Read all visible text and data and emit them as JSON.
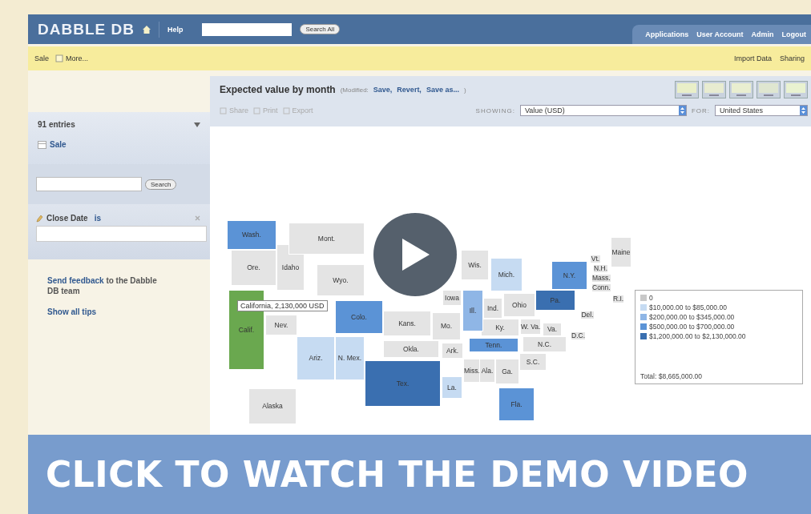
{
  "top_bar": {
    "logo": "DABBLE DB",
    "help": "Help",
    "search_button": "Search All",
    "nav": [
      "Applications",
      "User Account",
      "Admin",
      "Logout"
    ]
  },
  "sub_bar": {
    "left": [
      "Sale",
      "More..."
    ],
    "right": [
      "Import Data",
      "Sharing"
    ]
  },
  "sidebar": {
    "entries": "91 entries",
    "view_link": "Sale",
    "search_button": "Search",
    "filter": {
      "field": "Close Date",
      "operator": "is"
    },
    "feedback_link": "Send feedback",
    "feedback_rest": "to the Dabble DB team",
    "tips_link": "Show all tips"
  },
  "report": {
    "title": "Expected value by month",
    "modified": "(Modified:",
    "actions": [
      "Save,",
      "Revert,",
      "Save as..."
    ],
    "close_paren": ")",
    "tools": [
      {
        "label": "Share",
        "disabled": true
      },
      {
        "label": "Print",
        "disabled": true
      },
      {
        "label": "Export",
        "disabled": true
      }
    ],
    "showing_label": "SHOWING:",
    "showing_value": "Value (USD)",
    "for_label": "FOR:",
    "for_value": "United States"
  },
  "map": {
    "tooltip": "California, 2,130,000 USD",
    "states": [
      {
        "label": "Ore.",
        "color": "#e4e4e4"
      },
      {
        "label": "Idaho",
        "color": "#e4e4e4"
      },
      {
        "label": "Mont.",
        "color": "#e4e4e4"
      },
      {
        "label": "Wash.",
        "color": "#5b93d6"
      },
      {
        "label": "Wyo.",
        "color": "#e4e4e4"
      },
      {
        "label": "Nev.",
        "color": "#e4e4e4"
      },
      {
        "label": "Calif.",
        "color": "#6aa84f"
      },
      {
        "label": "Colo.",
        "color": "#5b93d6"
      },
      {
        "label": "Ariz.",
        "color": "#c6dbf2"
      },
      {
        "label": "N. Mex.",
        "color": "#c6dbf2"
      },
      {
        "label": "Kans.",
        "color": "#e4e4e4"
      },
      {
        "label": "Okla.",
        "color": "#e4e4e4"
      },
      {
        "label": "Tex.",
        "color": "#3a6fb0"
      },
      {
        "label": "Iowa",
        "color": "#e4e4e4"
      },
      {
        "label": "Mo.",
        "color": "#e4e4e4"
      },
      {
        "label": "Ark.",
        "color": "#e4e4e4"
      },
      {
        "label": "La.",
        "color": "#c6dbf2"
      },
      {
        "label": "Miss.",
        "color": "#e4e4e4"
      },
      {
        "label": "Ala.",
        "color": "#e4e4e4"
      },
      {
        "label": "Ga.",
        "color": "#e4e4e4"
      },
      {
        "label": "Fla.",
        "color": "#5b93d6"
      },
      {
        "label": "S.C.",
        "color": "#e4e4e4"
      },
      {
        "label": "N.C.",
        "color": "#e4e4e4"
      },
      {
        "label": "Ky.",
        "color": "#e4e4e4"
      },
      {
        "label": "Tenn.",
        "color": "#5b93d6"
      },
      {
        "label": "W. Va.",
        "color": "#e4e4e4"
      },
      {
        "label": "Va.",
        "color": "#e4e4e4"
      },
      {
        "label": "Wis.",
        "color": "#e4e4e4"
      },
      {
        "label": "Ill.",
        "color": "#8fb6e6"
      },
      {
        "label": "Ind.",
        "color": "#e4e4e4"
      },
      {
        "label": "Ohio",
        "color": "#e4e4e4"
      },
      {
        "label": "Mich.",
        "color": "#c6dbf2"
      },
      {
        "label": "Pa.",
        "color": "#3a6fb0"
      },
      {
        "label": "N.Y.",
        "color": "#5b93d6"
      },
      {
        "label": "Maine",
        "color": "#e4e4e4"
      },
      {
        "label": "Vt.",
        "color": "#e4e4e4"
      },
      {
        "label": "N.H.",
        "color": "#e4e4e4"
      },
      {
        "label": "Mass.",
        "color": "#e4e4e4"
      },
      {
        "label": "Conn.",
        "color": "#e4e4e4"
      },
      {
        "label": "R.I.",
        "color": "#e4e4e4"
      },
      {
        "label": "Del.",
        "color": "#e4e4e4"
      },
      {
        "label": "D.C.",
        "color": "#e4e4e4"
      },
      {
        "label": "Alaska",
        "color": "#e4e4e4"
      }
    ],
    "legend": {
      "items": [
        {
          "label": "0",
          "color": "#c8c8c8"
        },
        {
          "label": "$10,000.00 to $85,000.00",
          "color": "#c6dbf2"
        },
        {
          "label": "$200,000.00 to $345,000.00",
          "color": "#8fb6e6"
        },
        {
          "label": "$500,000.00 to $700,000.00",
          "color": "#5b93d6"
        },
        {
          "label": "$1,200,000.00 to $2,130,000.00",
          "color": "#3a6fb0"
        }
      ],
      "total": "Total: $8,665,000.00"
    }
  },
  "banner": "CLICK TO WATCH THE DEMO VIDEO"
}
